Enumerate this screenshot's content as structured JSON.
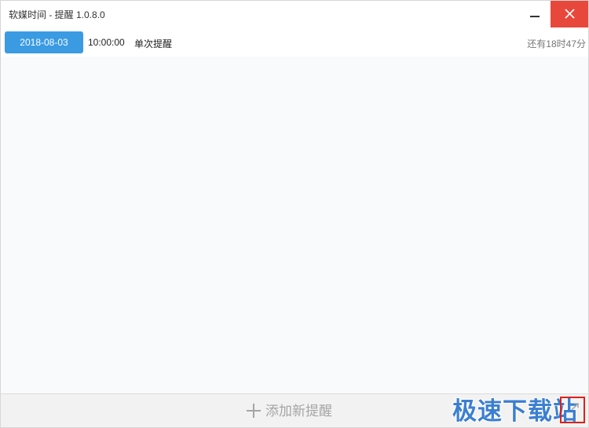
{
  "window": {
    "title": "软媒时间 - 提醒 1.0.8.0",
    "close_color": "#e8483b"
  },
  "reminders": [
    {
      "date": "2018-08-03",
      "time": "10:00:00",
      "type": "单次提醒",
      "remaining": "还有18时47分"
    }
  ],
  "footer": {
    "add_label": "添加新提醒",
    "add_icon": "plus-icon"
  },
  "watermark": {
    "text": "极速下载站"
  },
  "colors": {
    "accent": "#3a9be3"
  }
}
